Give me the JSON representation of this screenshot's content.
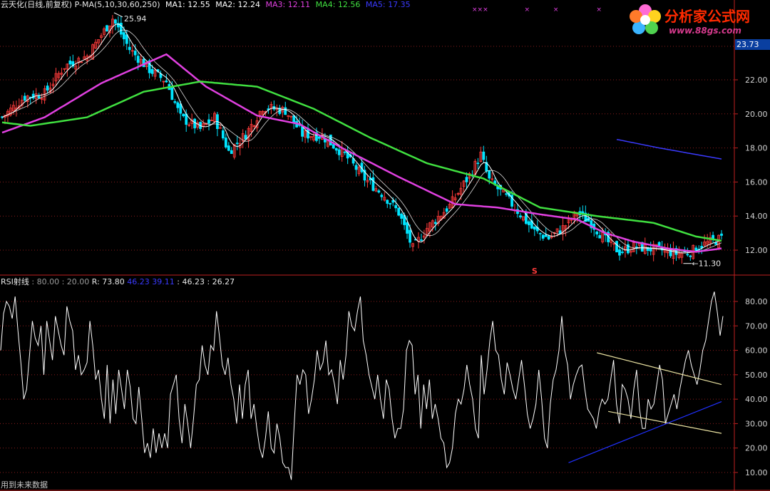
{
  "header": {
    "title": "云天化(日线,前复权)",
    "indicator": "P-MA(5,10,30,60,250)",
    "ma": [
      {
        "label": "MA1: 12.55",
        "color": "#ffffff"
      },
      {
        "label": "MA2: 12.24",
        "color": "#ffffff"
      },
      {
        "label": "MA3: 12.11",
        "color": "#e040e0"
      },
      {
        "label": "MA4: 12.56",
        "color": "#40e040"
      },
      {
        "label": "MA5: 17.35",
        "color": "#3a3aff"
      }
    ],
    "markers": [
      "×××",
      "×",
      "×",
      "×"
    ]
  },
  "logo": {
    "cn": "分析家公式网",
    "url": "www.88gs.com"
  },
  "rsi_header": {
    "name": "RSI射线",
    "params": ": 80.00 : 20.00",
    "r_label": "R: 73.80",
    "val1": "46.23",
    "val2": "39.11",
    "val3": ": 46.23",
    "val4": ": 26.27"
  },
  "footer": {
    "note": "用到未来数据"
  },
  "colors": {
    "up": "#ff3b3b",
    "down": "#00e5ff",
    "ma5": "#ffffff",
    "ma10": "#ffffff",
    "ma30": "#e040e0",
    "ma60": "#40e040",
    "ma250": "#3a3aff",
    "grid": "#8a1c1c",
    "axis": "#c02020",
    "rsi": "#ffffff",
    "upper": "#e8e0a0",
    "lower": "#2030ff"
  },
  "chart_data": [
    {
      "type": "candlestick",
      "title": "云天化(日线,前复权)",
      "yticks": [
        "12.00",
        "14.00",
        "16.00",
        "18.00",
        "20.00",
        "22.00"
      ],
      "ylim": [
        11.2,
        24.0
      ],
      "current_price": "23.73",
      "annotations": [
        {
          "text": "25.94",
          "x": 39,
          "y": 25.94
        },
        {
          "text": "11.30",
          "x": 240,
          "y": 11.3
        },
        {
          "text": "S",
          "x": 188,
          "y": 11.5
        }
      ],
      "n": 255,
      "close_anchors": [
        [
          0,
          19.8
        ],
        [
          8,
          21.0
        ],
        [
          15,
          21.2
        ],
        [
          22,
          22.8
        ],
        [
          30,
          23.4
        ],
        [
          39,
          25.6
        ],
        [
          45,
          23.8
        ],
        [
          52,
          22.6
        ],
        [
          58,
          21.9
        ],
        [
          63,
          19.8
        ],
        [
          70,
          19.1
        ],
        [
          75,
          19.8
        ],
        [
          80,
          17.8
        ],
        [
          86,
          18.8
        ],
        [
          92,
          20.4
        ],
        [
          100,
          20.2
        ],
        [
          106,
          18.8
        ],
        [
          113,
          18.7
        ],
        [
          121,
          17.6
        ],
        [
          128,
          16.2
        ],
        [
          135,
          15.2
        ],
        [
          140,
          14.2
        ],
        [
          145,
          12.1
        ],
        [
          150,
          13.3
        ],
        [
          158,
          14.6
        ],
        [
          165,
          16.4
        ],
        [
          169,
          17.6
        ],
        [
          172,
          16.1
        ],
        [
          178,
          15.1
        ],
        [
          183,
          14.1
        ],
        [
          188,
          13.1
        ],
        [
          193,
          12.7
        ],
        [
          198,
          13.3
        ],
        [
          203,
          14.2
        ],
        [
          208,
          13.6
        ],
        [
          213,
          12.6
        ],
        [
          218,
          11.9
        ],
        [
          223,
          12.2
        ],
        [
          228,
          12.1
        ],
        [
          233,
          12.0
        ],
        [
          238,
          11.8
        ],
        [
          243,
          11.9
        ],
        [
          247,
          12.3
        ],
        [
          254,
          12.7
        ]
      ],
      "ma_anchors": {
        "MA30": [
          [
            0,
            18.9
          ],
          [
            15,
            19.8
          ],
          [
            35,
            21.8
          ],
          [
            58,
            23.5
          ],
          [
            72,
            21.6
          ],
          [
            90,
            19.9
          ],
          [
            105,
            19.4
          ],
          [
            120,
            18.0
          ],
          [
            140,
            16.3
          ],
          [
            160,
            14.7
          ],
          [
            175,
            14.5
          ],
          [
            190,
            14.1
          ],
          [
            203,
            13.8
          ],
          [
            213,
            13.0
          ],
          [
            223,
            12.5
          ],
          [
            235,
            12.1
          ],
          [
            245,
            11.9
          ],
          [
            254,
            12.1
          ]
        ],
        "MA60": [
          [
            0,
            19.5
          ],
          [
            10,
            19.3
          ],
          [
            30,
            19.8
          ],
          [
            50,
            21.3
          ],
          [
            70,
            21.9
          ],
          [
            90,
            21.6
          ],
          [
            110,
            20.3
          ],
          [
            130,
            18.6
          ],
          [
            150,
            17.1
          ],
          [
            170,
            16.2
          ],
          [
            190,
            14.5
          ],
          [
            210,
            14.0
          ],
          [
            230,
            13.6
          ],
          [
            245,
            12.8
          ],
          [
            254,
            12.55
          ]
        ],
        "MA250": [
          [
            217,
            18.5
          ],
          [
            232,
            18.0
          ],
          [
            254,
            17.35
          ]
        ]
      }
    },
    {
      "type": "line",
      "title": "RSI射线",
      "series": [
        {
          "name": "R",
          "values": [
            60,
            75,
            80,
            78,
            73,
            82,
            68,
            55,
            40,
            44,
            58,
            72,
            65,
            62,
            70,
            50,
            72,
            64,
            56,
            74,
            68,
            62,
            58,
            78,
            72,
            68,
            52,
            58,
            50,
            52,
            55,
            72,
            62,
            48,
            52,
            40,
            32,
            54,
            30,
            48,
            34,
            52,
            44,
            36,
            52,
            45,
            32,
            30,
            45,
            32,
            18,
            22,
            16,
            28,
            18,
            26,
            20,
            26,
            20,
            42,
            46,
            50,
            32,
            22,
            38,
            30,
            20,
            32,
            46,
            48,
            62,
            54,
            50,
            62,
            60,
            76,
            66,
            54,
            50,
            57,
            46,
            40,
            30,
            46,
            32,
            46,
            52,
            32,
            38,
            28,
            20,
            16,
            24,
            35,
            20,
            18,
            30,
            24,
            14,
            12,
            12,
            7,
            30,
            50,
            46,
            52,
            50,
            34,
            40,
            48,
            60,
            52,
            55,
            64,
            50,
            52,
            46,
            38,
            56,
            48,
            58,
            76,
            70,
            68,
            76,
            82,
            64,
            58,
            50,
            45,
            40,
            50,
            40,
            32,
            48,
            44,
            32,
            24,
            28,
            28,
            36,
            60,
            64,
            62,
            42,
            50,
            28,
            46,
            36,
            48,
            32,
            38,
            32,
            24,
            22,
            12,
            14,
            20,
            34,
            40,
            38,
            44,
            54,
            46,
            40,
            28,
            24,
            58,
            42,
            52,
            64,
            72,
            60,
            58,
            48,
            42,
            55,
            50,
            44,
            40,
            48,
            56,
            46,
            34,
            28,
            32,
            38,
            52,
            40,
            24,
            20,
            38,
            48,
            52,
            60,
            74,
            60,
            54,
            40,
            46,
            50,
            53,
            54,
            44,
            36,
            34,
            32,
            28,
            36,
            40,
            38,
            40,
            48,
            56,
            38,
            30,
            46,
            44,
            40,
            32,
            44,
            52,
            36,
            28,
            28,
            40,
            36,
            38,
            46,
            54,
            48,
            30,
            34,
            38,
            42,
            36,
            44,
            50,
            56,
            60,
            54,
            50,
            46,
            52,
            60,
            64,
            72,
            80,
            84,
            76,
            66,
            74
          ]
        }
      ],
      "yticks": [
        "10.00",
        "20.00",
        "30.00",
        "40.00",
        "50.00",
        "60.00",
        "70.00",
        "80.00"
      ],
      "ylim": [
        7,
        90
      ],
      "trendlines": [
        {
          "name": "upper",
          "from": [
            210,
            59
          ],
          "to": [
            254,
            46
          ]
        },
        {
          "name": "lower_parallel",
          "from": [
            214,
            35
          ],
          "to": [
            254,
            26
          ]
        },
        {
          "name": "support",
          "from": [
            200,
            14
          ],
          "to": [
            254,
            39
          ]
        }
      ]
    }
  ]
}
